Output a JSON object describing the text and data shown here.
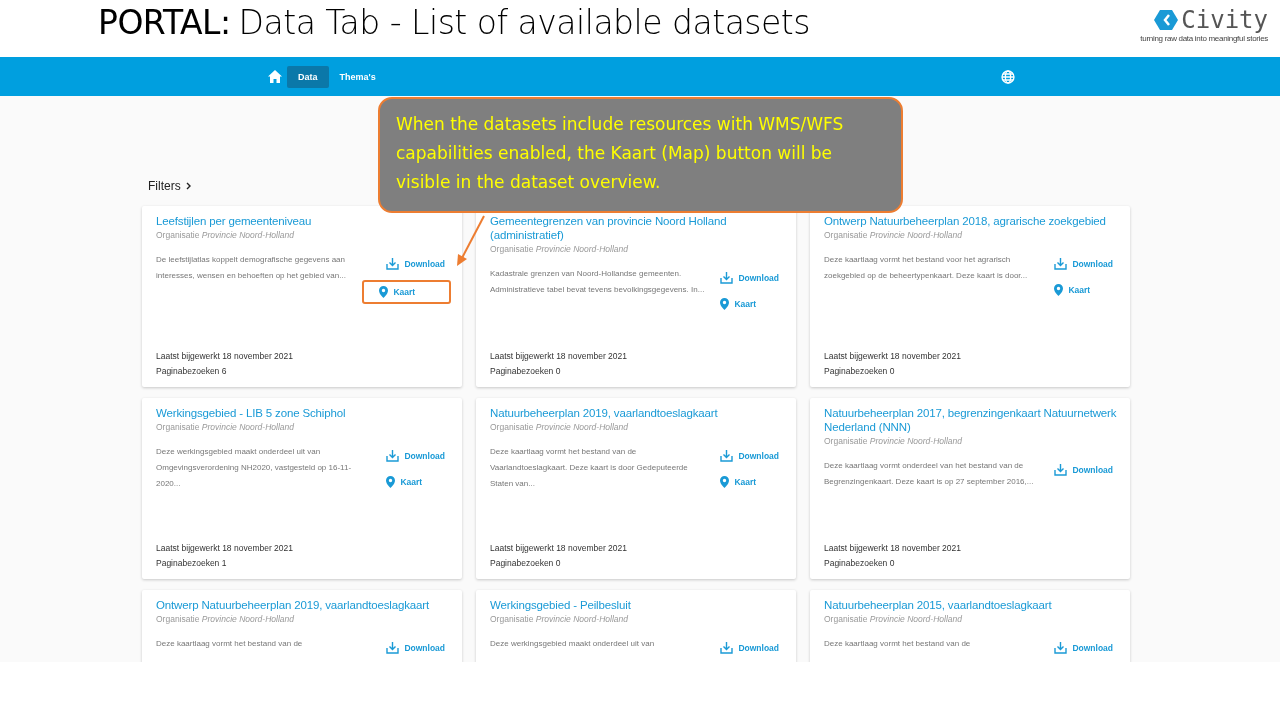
{
  "slide": {
    "title_bold": "PORTAL:",
    "title": "Data Tab - List of available datasets",
    "logo": {
      "name": "Civity",
      "tagline": "turning raw data into meaningful stories"
    }
  },
  "nav": {
    "tabs": [
      {
        "label": "Data",
        "selected": true
      },
      {
        "label": "Thema's",
        "selected": false
      }
    ]
  },
  "filters": {
    "label": "Filters"
  },
  "callout": {
    "text": "When the datasets include resources with WMS/WFS capabilities enabled, the Kaart (Map) button will be visible in the dataset overview."
  },
  "cards": [
    {
      "title": "Leefstijlen per gemeenteniveau",
      "org_label": "Organisatie",
      "org": "Provincie Noord-Holland",
      "description": "De leefstijlatlas koppelt demografische gegevens aan interesses, wensen en behoeften op het gebied van...",
      "actions": [
        {
          "kind": "download",
          "label": "Download",
          "highlighted": false
        },
        {
          "kind": "map",
          "label": "Kaart",
          "highlighted": true
        }
      ],
      "updated": "Laatst bijgewerkt 18 november 2021",
      "visits": "Paginabezoeken 6"
    },
    {
      "title": "Gemeentegrenzen van provincie Noord Holland (administratief)",
      "org_label": "Organisatie",
      "org": "Provincie Noord-Holland",
      "description": "Kadastrale grenzen van Noord-Hollandse gemeenten. Administratieve tabel bevat tevens bevolkingsgegevens. In...",
      "actions": [
        {
          "kind": "download",
          "label": "Download",
          "highlighted": false
        },
        {
          "kind": "map",
          "label": "Kaart",
          "highlighted": false
        }
      ],
      "updated": "Laatst bijgewerkt 18 november 2021",
      "visits": "Paginabezoeken 0"
    },
    {
      "title": "Ontwerp Natuurbeheerplan 2018, agrarische zoekgebied",
      "org_label": "Organisatie",
      "org": "Provincie Noord-Holland",
      "description": "Deze kaartlaag vormt het bestand voor het agrarisch zoekgebied op de beheertypenkaart. Deze kaart is door...",
      "actions": [
        {
          "kind": "download",
          "label": "Download",
          "highlighted": false
        },
        {
          "kind": "map",
          "label": "Kaart",
          "highlighted": false
        }
      ],
      "updated": "Laatst bijgewerkt 18 november 2021",
      "visits": "Paginabezoeken 0"
    },
    {
      "title": "Werkingsgebied - LIB 5 zone Schiphol",
      "org_label": "Organisatie",
      "org": "Provincie Noord-Holland",
      "description": "Deze werkingsgebied maakt onderdeel uit van Omgevingsverordening NH2020, vastgesteld op 16-11-2020...",
      "actions": [
        {
          "kind": "download",
          "label": "Download",
          "highlighted": false
        },
        {
          "kind": "map",
          "label": "Kaart",
          "highlighted": false
        }
      ],
      "updated": "Laatst bijgewerkt 18 november 2021",
      "visits": "Paginabezoeken 1"
    },
    {
      "title": "Natuurbeheerplan 2019, vaarlandtoeslagkaart",
      "org_label": "Organisatie",
      "org": "Provincie Noord-Holland",
      "description": "Deze kaartlaag vormt het bestand van de Vaarlandtoeslagkaart. Deze kaart is door Gedeputeerde Staten van...",
      "actions": [
        {
          "kind": "download",
          "label": "Download",
          "highlighted": false
        },
        {
          "kind": "map",
          "label": "Kaart",
          "highlighted": false
        }
      ],
      "updated": "Laatst bijgewerkt 18 november 2021",
      "visits": "Paginabezoeken 0"
    },
    {
      "title": "Natuurbeheerplan 2017, begrenzingenkaart Natuurnetwerk Nederland (NNN)",
      "org_label": "Organisatie",
      "org": "Provincie Noord-Holland",
      "description": "Deze kaartlaag vormt onderdeel van het bestand van de Begrenzingenkaart. Deze kaart is op 27 september 2016,...",
      "actions": [
        {
          "kind": "download",
          "label": "Download",
          "highlighted": false
        }
      ],
      "updated": "Laatst bijgewerkt 18 november 2021",
      "visits": "Paginabezoeken 0"
    },
    {
      "title": "Ontwerp Natuurbeheerplan 2019, vaarlandtoeslagkaart",
      "org_label": "Organisatie",
      "org": "Provincie Noord-Holland",
      "description": "Deze kaartlaag vormt het bestand van de",
      "actions": [
        {
          "kind": "download",
          "label": "Download",
          "highlighted": false
        }
      ]
    },
    {
      "title": "Werkingsgebied - Peilbesluit",
      "org_label": "Organisatie",
      "org": "Provincie Noord-Holland",
      "description": "Deze werkingsgebied maakt onderdeel uit van",
      "actions": [
        {
          "kind": "download",
          "label": "Download",
          "highlighted": false
        }
      ]
    },
    {
      "title": "Natuurbeheerplan 2015, vaarlandtoeslagkaart",
      "org_label": "Organisatie",
      "org": "Provincie Noord-Holland",
      "description": "Deze kaartlaag vormt het bestand van de",
      "actions": [
        {
          "kind": "download",
          "label": "Download",
          "highlighted": false
        }
      ]
    }
  ]
}
